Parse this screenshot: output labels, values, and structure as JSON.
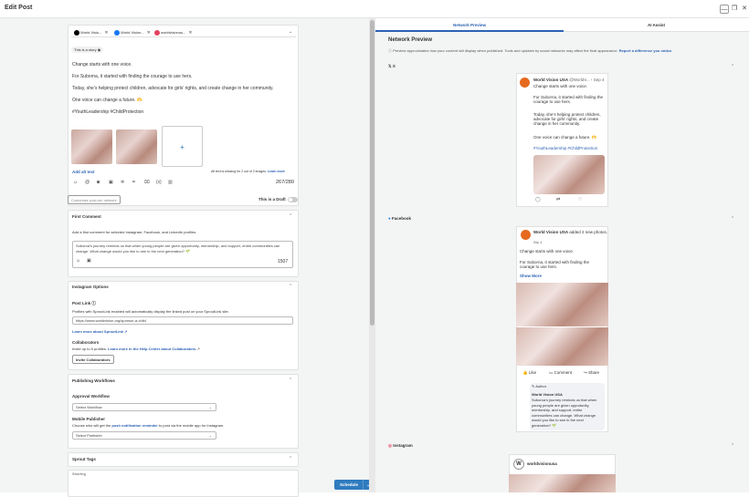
{
  "window": {
    "title": "Edit Post"
  },
  "editor": {
    "profiles": [
      "World Visio...",
      "World Vision...",
      "worldvisionus..."
    ],
    "story_label": "This is a story",
    "body_lines": [
      "Change starts with one voice.",
      "For Suborna, it started with finding the courage to use hers.",
      "Today, she’s helping protect children, advocate for girls’ rights, and create change in her community.",
      "One voice can change a future. 🫶",
      "#YouthLeadership #ChildProtection"
    ],
    "add_alt_text": "Add alt text",
    "alt_text_notice": "Alt text is missing for 2 out of 2 images.",
    "learn_more": "Learn more",
    "char_count": "267/280",
    "customize_label": "Customize post per network",
    "draft_label": "This is a Draft"
  },
  "first_comment": {
    "header": "First Comment",
    "description": "Add a first comment for selected Instagram, Facebook, and LinkedIn profiles.",
    "text": "Suborna’s journey reminds us that when young people are given opportunity, mentorship, and support, entire communities can change. What change would you like to see in the next generation? 🌱",
    "count": "1507"
  },
  "instagram_options": {
    "header": "Instagram Options",
    "post_link_label": "Post Link",
    "post_link_desc": "Profiles with SproutLink enabled will automatically display the linked post on your SproutLink site.",
    "url": "https://www.worldvision.org/sponsor-a-child",
    "learn_sproutlink": "Learn more about SproutLink",
    "collaborators_label": "Collaborators",
    "collaborators_desc": "Invite up to 5 profiles.",
    "learn_collab": "Learn more in the Help Center about Collaborators",
    "invite_button": "Invite Collaborators"
  },
  "publishing": {
    "header": "Publishing Workflows",
    "approval_label": "Approval Workflow",
    "approval_placeholder": "Select Workflow",
    "mobile_label": "Mobile Publisher",
    "mobile_desc_a": "Choose who will get the",
    "mobile_desc_link": "push notification reminder",
    "mobile_desc_b": "to post via the mobile app for Instagram.",
    "mobile_placeholder": "Select Publisher"
  },
  "sprout_tags": {
    "header": "Sprout Tags"
  },
  "more_label": "Sharing",
  "schedule_button": "Schedule",
  "preview": {
    "tab_network": "Network Preview",
    "tab_ai": "AI Assist",
    "heading": "Network Preview",
    "note": "Preview approximates how your content will display when published. Tools and updates by social networks may affect the final appearance.",
    "report_link": "Report a difference you notice.",
    "x_label": "X",
    "x_post": {
      "account": "World Vision USA",
      "handle": "@WorldV...",
      "date": "Sep 4",
      "lines": [
        "Change starts with one voice.",
        "For Suborna, it started with finding the courage to use hers.",
        "Today, she’s helping protect children, advocate for girls’ rights, and create change in her community.",
        "One voice can change a future. 🫶",
        "#YouthLeadership #ChildProtection"
      ]
    },
    "facebook_label": "Facebook",
    "fb_post": {
      "account": "World Vision USA",
      "added": "added 2 new photos.",
      "date": "Sep 4",
      "lines": [
        "Change starts with one voice.",
        "For Suborna, it started with finding the courage to use hers."
      ],
      "show_more": "Show More",
      "like": "Like",
      "comment": "Comment",
      "share": "Share",
      "author": "Author",
      "comment_account": "World Vision USA",
      "comment_text": "Suborna’s journey reminds us that when young people are given opportunity, mentorship, and support, entire communities can change. What change would you like to see in the next generation? 🌱"
    },
    "instagram_label": "Instagram",
    "ig_post": {
      "account": "worldvisionusa"
    }
  },
  "colors": {
    "accent": "#2d62b4",
    "schedule": "#2f7bbf",
    "x": "#000000",
    "facebook": "#1877f2",
    "instagram": "#e4405f"
  }
}
